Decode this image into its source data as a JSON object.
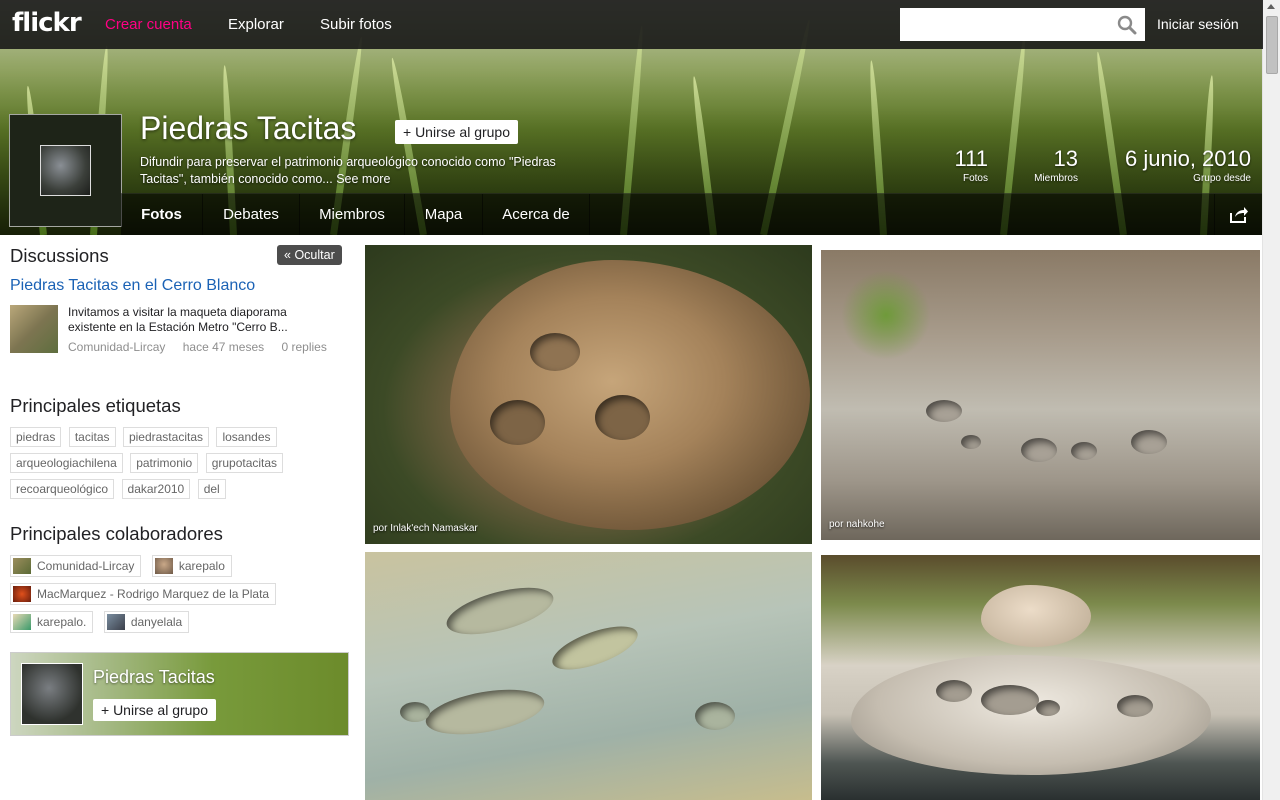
{
  "nav": {
    "logo": "flickr",
    "create_account": "Crear cuenta",
    "explore": "Explorar",
    "upload": "Subir fotos",
    "search_placeholder": "",
    "signin": "Iniciar sesión"
  },
  "group": {
    "name": "Piedras Tacitas",
    "join_label": "+ Unirse al grupo",
    "description": "Difundir para preservar el patrimonio arqueológico conocido como \"Piedras Tacitas\", también conocido como...",
    "see_more": "See more",
    "stats": {
      "photos_num": "111",
      "photos_label": "Fotos",
      "members_num": "13",
      "members_label": "Miembros",
      "since_num": "6 junio, 2010",
      "since_label": "Grupo desde"
    }
  },
  "tabs": [
    {
      "label": "Fotos",
      "active": true
    },
    {
      "label": "Debates"
    },
    {
      "label": "Miembros"
    },
    {
      "label": "Mapa"
    },
    {
      "label": "Acerca de"
    }
  ],
  "sidebar": {
    "discussions_heading": "Discussions",
    "hide_label": "Ocultar",
    "discussion": {
      "title": "Piedras Tacitas en el Cerro Blanco",
      "excerpt": "Invitamos a visitar la maqueta diaporama existente en la Estación Metro \"Cerro B...",
      "author": "Comunidad-Lircay",
      "time": "hace 47 meses",
      "replies": "0 replies"
    },
    "tags_heading": "Principales etiquetas",
    "tags": [
      "piedras",
      "tacitas",
      "piedrastacitas",
      "losandes",
      "arqueologiachilena",
      "patrimonio",
      "grupotacitas",
      "recoarqueológico",
      "dakar2010",
      "del"
    ],
    "contributors_heading": "Principales colaboradores",
    "contributors": [
      "Comunidad-Lircay",
      "karepalo",
      "MacMarquez - Rodrigo Marquez de la Plata",
      "karepalo.",
      "danyelala"
    ],
    "promo": {
      "title": "Piedras Tacitas",
      "join_label": "+ Unirse al grupo"
    }
  },
  "photos": [
    {
      "credit": "por Inlak'ech Namaskar"
    },
    {
      "credit": "por nahkohe"
    },
    {
      "credit": ""
    },
    {
      "credit": ""
    }
  ],
  "colors": {
    "accent_pink": "#ff0084",
    "link_blue": "#1b62b5"
  }
}
